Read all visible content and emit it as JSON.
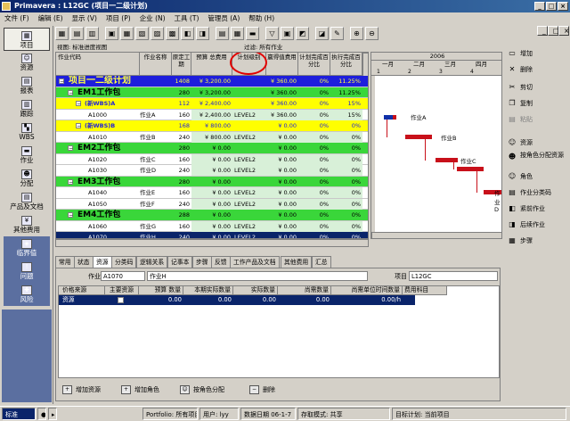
{
  "title": "Primavera : L12GC (项目一二级计划)",
  "menu": [
    "文件 (F)",
    "编辑 (E)",
    "显示 (V)",
    "项目 (P)",
    "企业 (N)",
    "工具 (T)",
    "管理员 (A)",
    "帮助 (H)"
  ],
  "nav": [
    "项目",
    "资源",
    "报表",
    "跟踪",
    "WBS",
    "作业",
    "分配",
    "产品及文档",
    "其他费用",
    "临界值",
    "问题",
    "风险"
  ],
  "view": {
    "label": "视图: 标准进度视图",
    "filter": "过滤: 所有作业"
  },
  "columns": [
    "作业代码",
    "作业名称",
    "原定工期",
    "预算 总费用",
    "计划级别",
    "赢得值费用",
    "计划完成百分比",
    "执行完成百分比"
  ],
  "rows": [
    {
      "code": "项目一二级计划",
      "name": "",
      "dur": "1408",
      "cost": "¥ 3,200.00",
      "lvl": "",
      "ev": "¥ 360.00",
      "pp": "0%",
      "ep": "11.25%",
      "kind": "proj"
    },
    {
      "code": "EM1工作包",
      "name": "",
      "dur": "280",
      "cost": "¥ 3,200.00",
      "lvl": "",
      "ev": "¥ 360.00",
      "pp": "0%",
      "ep": "11.25%",
      "kind": "wbs1"
    },
    {
      "code": "(新WBS)A",
      "name": "",
      "dur": "112",
      "cost": "¥ 2,400.00",
      "lvl": "",
      "ev": "¥ 360.00",
      "pp": "0%",
      "ep": "15%",
      "kind": "wbs2"
    },
    {
      "code": "A1000",
      "name": "作业A",
      "dur": "160",
      "cost": "¥ 2,400.00",
      "lvl": "LEVEL2",
      "ev": "¥ 360.00",
      "pp": "0%",
      "ep": "15%",
      "kind": "act"
    },
    {
      "code": "(新WBS)B",
      "name": "",
      "dur": "168",
      "cost": "¥ 800.00",
      "lvl": "",
      "ev": "¥ 0.00",
      "pp": "0%",
      "ep": "0%",
      "kind": "wbs2"
    },
    {
      "code": "A1010",
      "name": "作业B",
      "dur": "240",
      "cost": "¥ 800.00",
      "lvl": "LEVEL2",
      "ev": "¥ 0.00",
      "pp": "0%",
      "ep": "0%",
      "kind": "act"
    },
    {
      "code": "EM2工作包",
      "name": "",
      "dur": "280",
      "cost": "¥ 0.00",
      "lvl": "",
      "ev": "¥ 0.00",
      "pp": "0%",
      "ep": "0%",
      "kind": "wbs1"
    },
    {
      "code": "A1020",
      "name": "作业C",
      "dur": "160",
      "cost": "¥ 0.00",
      "lvl": "LEVEL2",
      "ev": "¥ 0.00",
      "pp": "0%",
      "ep": "0%",
      "kind": "act"
    },
    {
      "code": "A1030",
      "name": "作业D",
      "dur": "240",
      "cost": "¥ 0.00",
      "lvl": "LEVEL2",
      "ev": "¥ 0.00",
      "pp": "0%",
      "ep": "0%",
      "kind": "act"
    },
    {
      "code": "EM3工作包",
      "name": "",
      "dur": "280",
      "cost": "¥ 0.00",
      "lvl": "",
      "ev": "¥ 0.00",
      "pp": "0%",
      "ep": "0%",
      "kind": "wbs1"
    },
    {
      "code": "A1040",
      "name": "作业E",
      "dur": "160",
      "cost": "¥ 0.00",
      "lvl": "LEVEL2",
      "ev": "¥ 0.00",
      "pp": "0%",
      "ep": "0%",
      "kind": "act"
    },
    {
      "code": "A1050",
      "name": "作业F",
      "dur": "240",
      "cost": "¥ 0.00",
      "lvl": "LEVEL2",
      "ev": "¥ 0.00",
      "pp": "0%",
      "ep": "0%",
      "kind": "act"
    },
    {
      "code": "EM4工作包",
      "name": "",
      "dur": "288",
      "cost": "¥ 0.00",
      "lvl": "",
      "ev": "¥ 0.00",
      "pp": "0%",
      "ep": "0%",
      "kind": "wbs1"
    },
    {
      "code": "A1060",
      "name": "作业G",
      "dur": "160",
      "cost": "¥ 0.00",
      "lvl": "LEVEL2",
      "ev": "¥ 0.00",
      "pp": "0%",
      "ep": "0%",
      "kind": "act"
    },
    {
      "code": "A1070",
      "name": "作业H",
      "dur": "240",
      "cost": "¥ 0.00",
      "lvl": "LEVEL2",
      "ev": "¥ 0.00",
      "pp": "0%",
      "ep": "0%",
      "kind": "sel"
    }
  ],
  "gantt": {
    "year": "2006",
    "months": [
      "一月",
      "二月",
      "三月",
      "四月"
    ],
    "weeks": [
      "1",
      "2",
      "3",
      "4"
    ],
    "labels": [
      "作业A",
      "作业B",
      "作业C",
      "作业D"
    ]
  },
  "right_buttons": [
    "增加",
    "删除",
    "剪切",
    "复制",
    "粘贴",
    "资源",
    "按角色分配资源",
    "角色",
    "作业分类码",
    "紧前作业",
    "后续作业",
    "步骤"
  ],
  "tabs": [
    "常用",
    "状态",
    "资源",
    "分类码",
    "逻辑关系",
    "记事本",
    "步骤",
    "反馈",
    "工作产品及文档",
    "其他费用",
    "汇总"
  ],
  "detail": {
    "activity_label": "作业",
    "activity_code": "A1070",
    "activity_name": "作业H",
    "project_label": "项目",
    "project_code": "L12GC",
    "headers": [
      "价格来源",
      "主要资源",
      "预算 数量",
      "本期实际数量",
      "实际数量",
      "尚需数量",
      "尚需单位时间数量",
      "费用科目"
    ],
    "row": [
      "资源",
      "",
      "0.00",
      "0.00",
      "0.00",
      "0.00",
      "0.00/h",
      ""
    ],
    "buttons": [
      "增加资源",
      "增加角色",
      "按角色分配",
      "删除"
    ]
  },
  "status": {
    "left": "标准",
    "portfolio": "Portfolio: 所有项目",
    "user": "用户: lyy",
    "date": "数据日期 06-1-7",
    "mode": "存取模式: 共享",
    "baseline": "目标计划: 当前项目"
  }
}
